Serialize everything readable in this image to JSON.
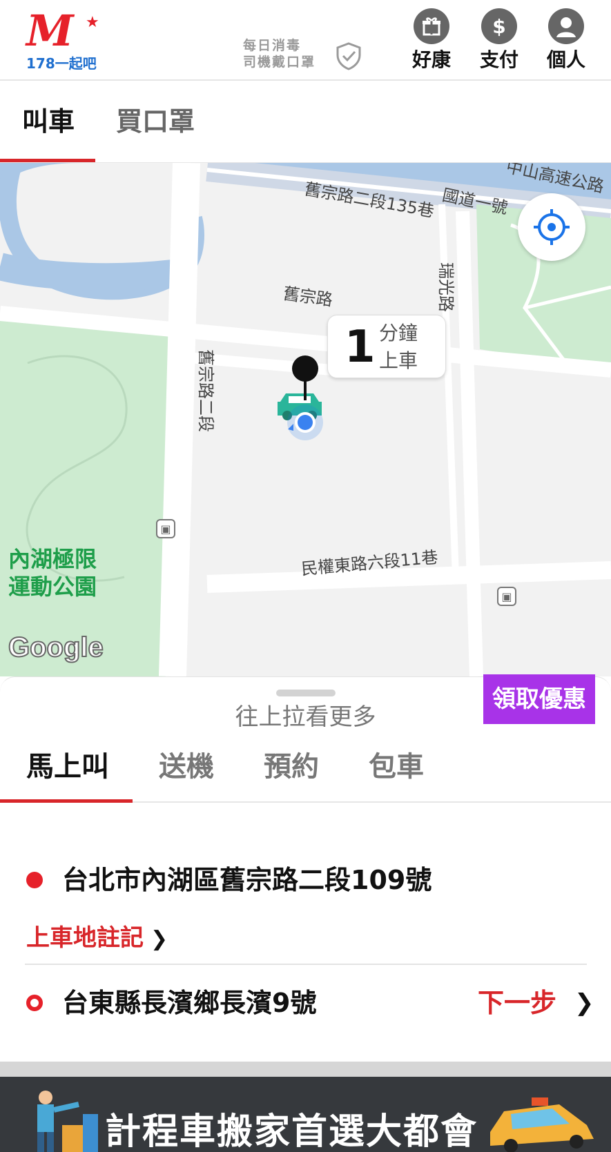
{
  "header": {
    "logo_letter": "M",
    "logo_subtitle": "178一起吧",
    "daily_notice_line1": "每日消毒",
    "daily_notice_line2": "司機戴口罩",
    "icons": [
      {
        "label": "好康",
        "icon": "gift-icon"
      },
      {
        "label": "支付",
        "icon": "dollar-icon"
      },
      {
        "label": "個人",
        "icon": "person-icon"
      }
    ]
  },
  "top_tabs": {
    "items": [
      "叫車",
      "買口罩"
    ],
    "active_index": 0
  },
  "map": {
    "road_labels": {
      "highway": "中山高速公路",
      "national_road": "國道一號",
      "lane_135": "舊宗路二段135巷",
      "ruiguang": "瑞光路",
      "jiuzong": "舊宗路",
      "jiuzong_sec2": "舊宗路二段",
      "minquan_lane": "民權東路六段11巷"
    },
    "park_name_line1": "內湖極限",
    "park_name_line2": "運動公園",
    "google_label": "Google",
    "eta_minutes": "1",
    "eta_unit": "分鐘",
    "eta_action": "上車"
  },
  "sheet": {
    "pull_hint": "往上拉看更多",
    "promo_label": "領取優惠",
    "ride_tabs": [
      "馬上叫",
      "送機",
      "預約",
      "包車"
    ],
    "active_ride_tab": 0,
    "pickup_address": "台北市內湖區舊宗路二段109號",
    "pickup_note_label": "上車地註記",
    "destination_address": "台東縣長濱鄉長濱9號",
    "next_label": "下一步"
  },
  "banner": {
    "text": "計程車搬家首選大都會"
  },
  "colors": {
    "brand_red": "#d8262a",
    "promo_purple": "#a833e8",
    "map_green": "#cdebd0",
    "map_water": "#aac7e6"
  }
}
